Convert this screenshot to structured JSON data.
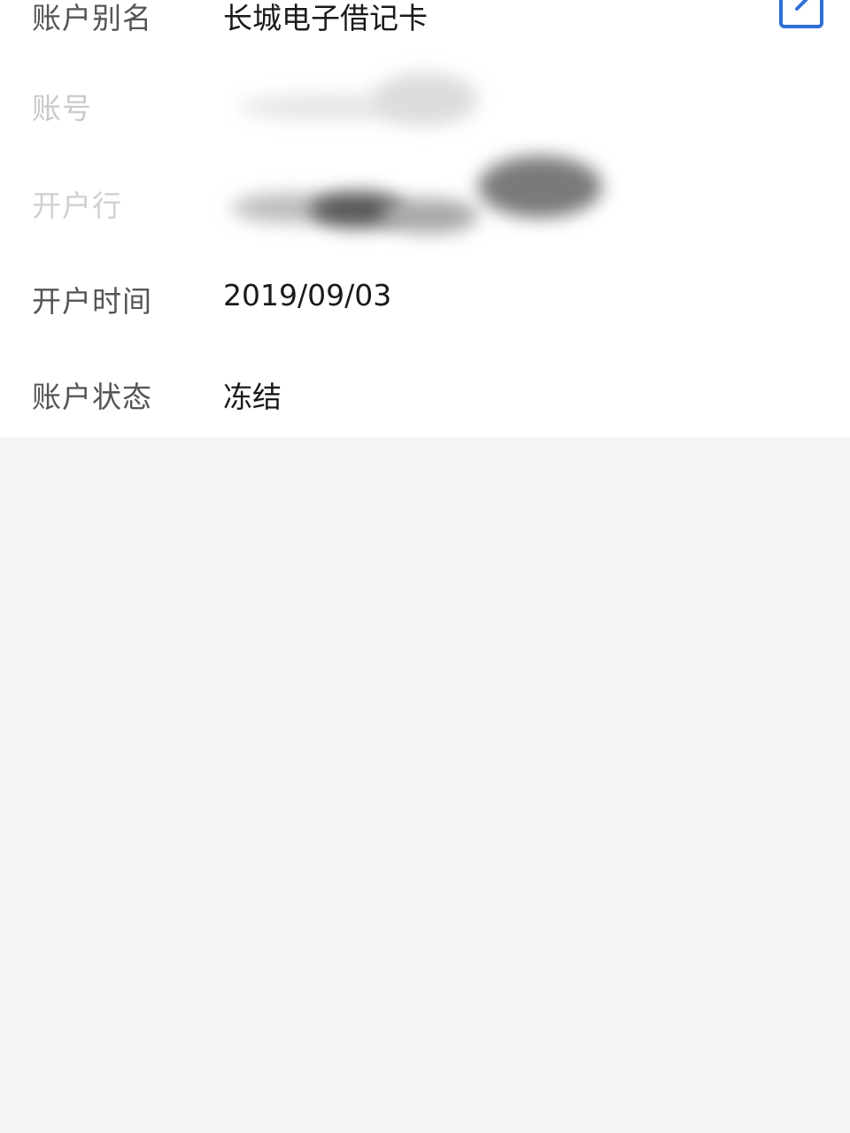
{
  "details": {
    "alias": {
      "label": "账户别名",
      "value": "长城电子借记卡"
    },
    "account": {
      "label": "账号"
    },
    "branch": {
      "label": "开户行"
    },
    "open_date": {
      "label": "开户时间",
      "value": "2019/09/03"
    },
    "status": {
      "label": "账户状态",
      "value": "冻结"
    }
  },
  "icons": {
    "edit": "edit-icon"
  },
  "colors": {
    "accent": "#2f6fd6",
    "panel": "#ffffff",
    "background": "#f4f4f3"
  }
}
